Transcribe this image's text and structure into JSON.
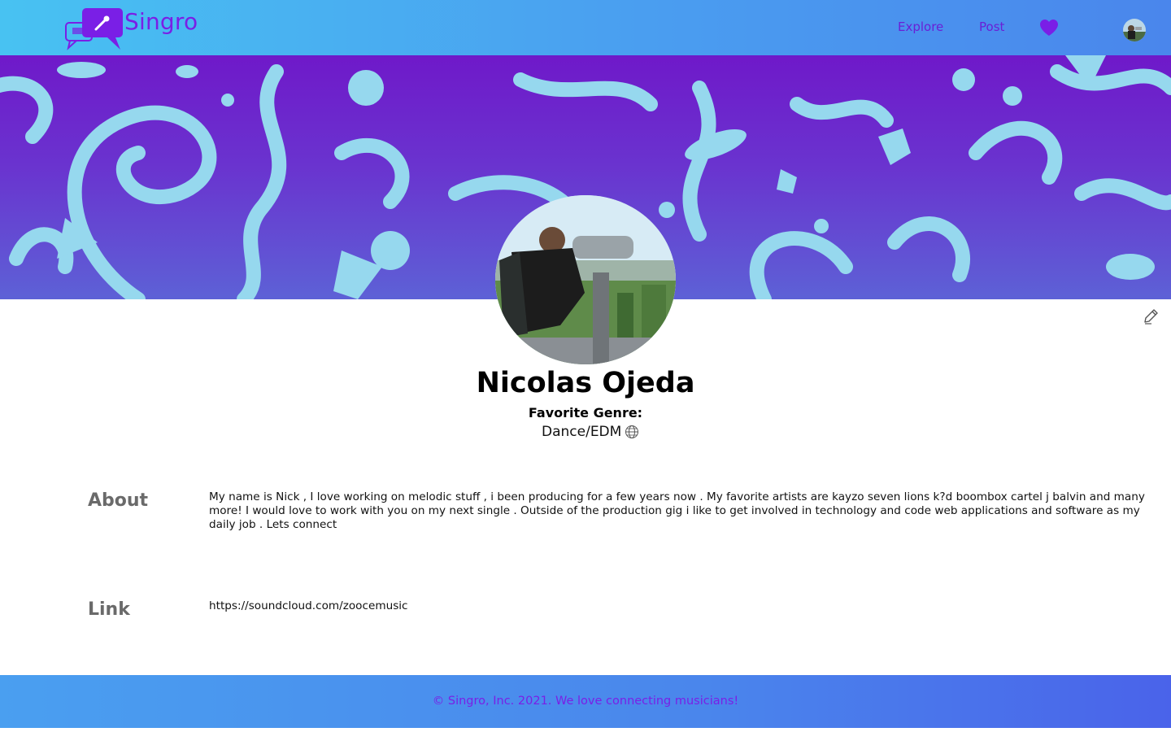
{
  "app": {
    "name": "Singro"
  },
  "nav": {
    "explore": "Explore",
    "post": "Post"
  },
  "icons": {
    "logo": "chat-bubble-microphone-logo",
    "favorites": "heart-icon",
    "edit": "pencil-icon",
    "genre": "globe-icon"
  },
  "profile": {
    "name": "Nicolas Ojeda",
    "genre_label": "Favorite Genre:",
    "genre": "Dance/EDM"
  },
  "about": {
    "title": "About",
    "text": "My name is Nick , I love working on melodic stuff , i been producing for a few years now . My favorite artists are kayzo seven lions k?d boombox cartel j balvin and many more! I would love to work with you on my next single . Outside of the production gig i like to get involved in technology and code web applications and software as my daily job . Lets connect"
  },
  "link": {
    "title": "Link",
    "url": "https://soundcloud.com/zoocemusic"
  },
  "footer": {
    "text": "© Singro, Inc. 2021. We love connecting musicians!"
  },
  "colors": {
    "brand_purple": "#7a1fe6",
    "banner_top": "#6f19c9",
    "banner_bottom": "#5d61d6",
    "doodle": "#96d8ee",
    "header_start": "#48c2f2",
    "footer_end": "#4a63ea"
  }
}
